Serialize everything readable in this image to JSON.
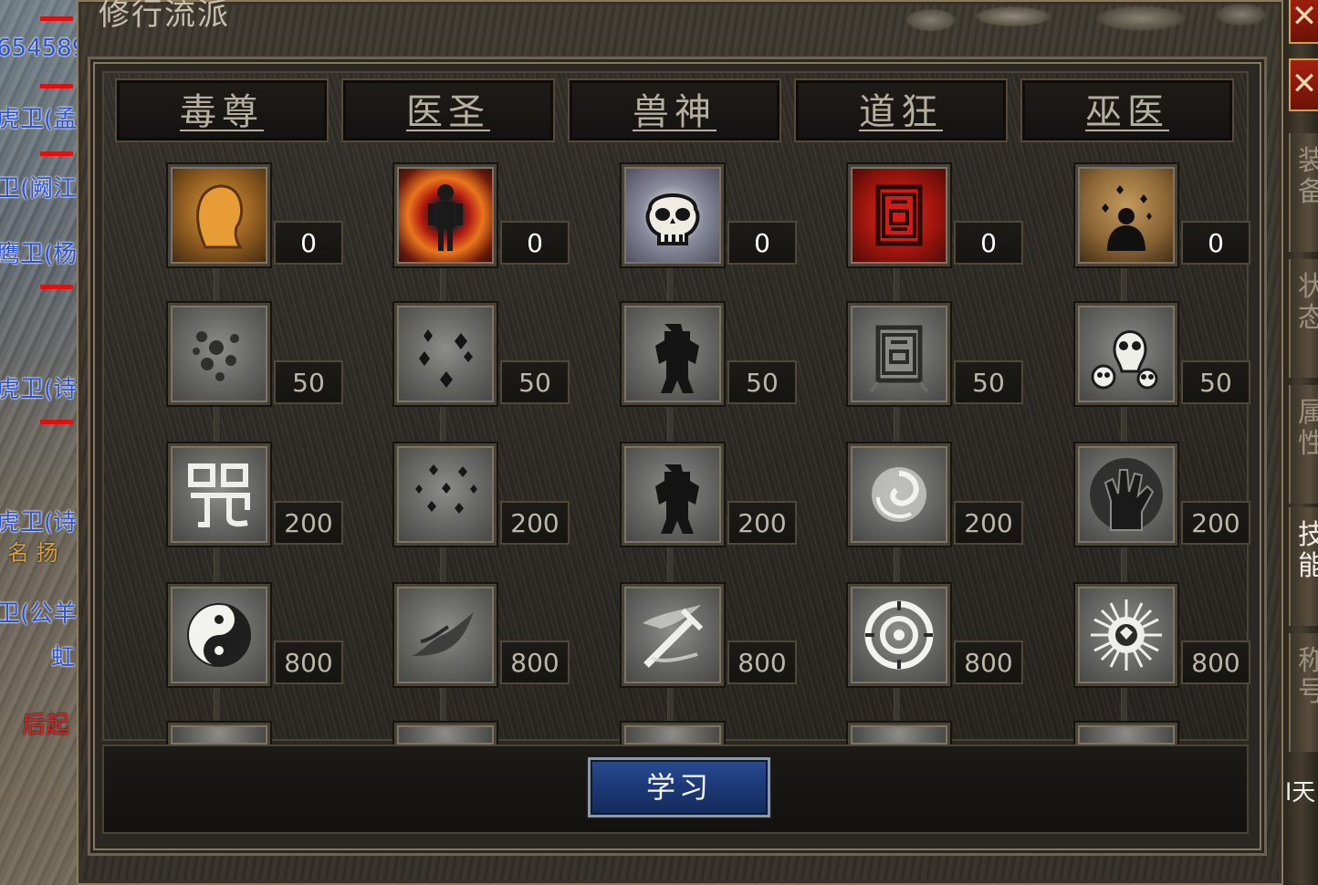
{
  "window": {
    "title": "修行流派"
  },
  "left_bg": {
    "names": [
      "654589",
      "虎卫(孟",
      "卫(阙江",
      "鹰卫(杨",
      "虎卫(诗",
      "虎卫(诗",
      "名 扬",
      "卫(公羊",
      "虹",
      "后起"
    ]
  },
  "sidebar": {
    "close_label": "✕",
    "tabs": [
      {
        "label": "装备"
      },
      {
        "label": "状态"
      },
      {
        "label": "属性"
      },
      {
        "label": "技能"
      },
      {
        "label": "称号"
      }
    ],
    "bottom_text": "l天"
  },
  "tabs": [
    {
      "label": "毒尊"
    },
    {
      "label": "医圣"
    },
    {
      "label": "兽神"
    },
    {
      "label": "道狂"
    },
    {
      "label": "巫医"
    }
  ],
  "columns": [
    {
      "skills": [
        {
          "icon": "head-silhouette-icon",
          "cost": "0"
        },
        {
          "icon": "poison-cloud-icon",
          "cost": "50"
        },
        {
          "icon": "curse-rune-icon",
          "cost": "200"
        },
        {
          "icon": "yin-yang-icon",
          "cost": "800"
        }
      ]
    },
    {
      "skills": [
        {
          "icon": "red-aura-figure-icon",
          "cost": "0"
        },
        {
          "icon": "scattered-stars-icon",
          "cost": "50"
        },
        {
          "icon": "star-cluster-icon",
          "cost": "200"
        },
        {
          "icon": "shadow-dragon-icon",
          "cost": "800"
        }
      ]
    },
    {
      "skills": [
        {
          "icon": "skull-mask-icon",
          "cost": "0"
        },
        {
          "icon": "beast-warrior-icon",
          "cost": "50"
        },
        {
          "icon": "beast-warrior-icon",
          "cost": "200"
        },
        {
          "icon": "flaming-sword-icon",
          "cost": "800"
        }
      ]
    },
    {
      "skills": [
        {
          "icon": "red-seal-icon",
          "cost": "0"
        },
        {
          "icon": "gray-seal-icon",
          "cost": "50"
        },
        {
          "icon": "vortex-icon",
          "cost": "200"
        },
        {
          "icon": "ring-sigil-icon",
          "cost": "800"
        }
      ]
    },
    {
      "skills": [
        {
          "icon": "sparkle-figure-icon",
          "cost": "0"
        },
        {
          "icon": "skulls-icon",
          "cost": "50"
        },
        {
          "icon": "clutching-hand-icon",
          "cost": "200"
        },
        {
          "icon": "spiked-sun-icon",
          "cost": "800"
        }
      ]
    }
  ],
  "learn_button": {
    "label": "学习"
  }
}
